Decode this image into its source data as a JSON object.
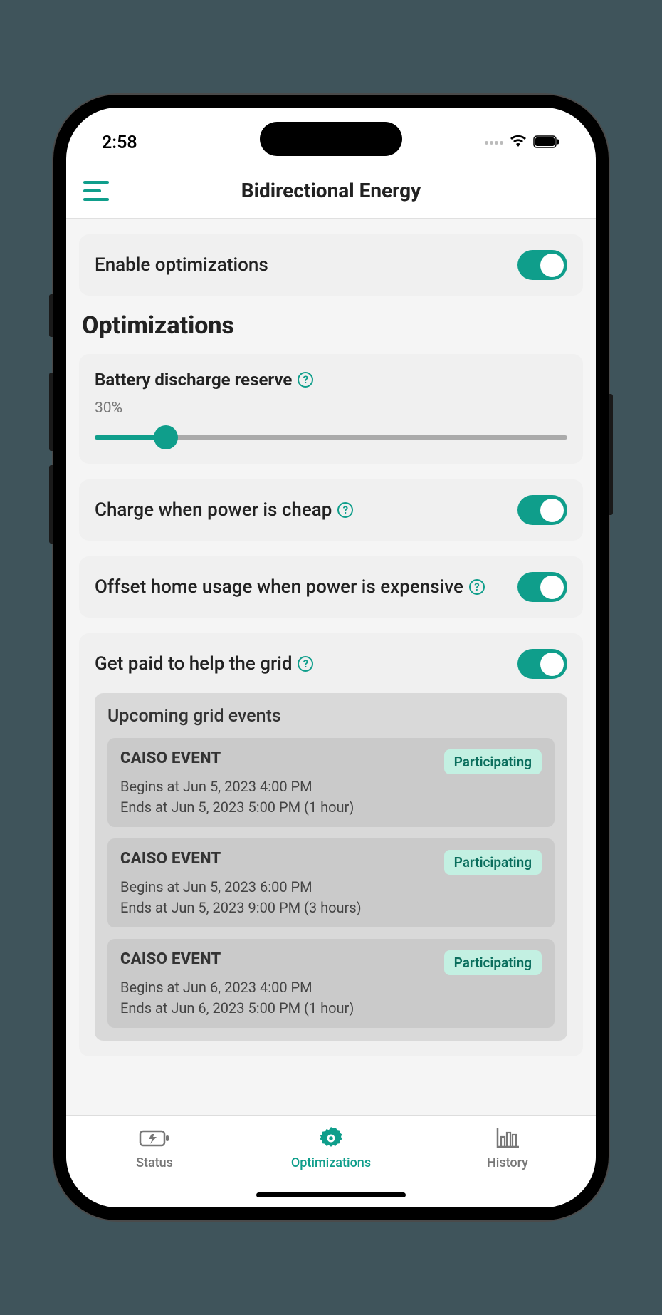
{
  "status_bar": {
    "time": "2:58"
  },
  "header": {
    "title": "Bidirectional Energy"
  },
  "enable": {
    "label": "Enable optimizations",
    "on": true
  },
  "section_title": "Optimizations",
  "battery": {
    "label": "Battery discharge reserve",
    "value_text": "30%",
    "value_pct": 15
  },
  "opts": [
    {
      "label": "Charge when power is cheap",
      "on": true
    },
    {
      "label": "Offset home usage when power is expensive",
      "on": true
    }
  ],
  "grid": {
    "label": "Get paid to help the grid",
    "on": true,
    "sub_title": "Upcoming grid events",
    "events": [
      {
        "name": "CAISO EVENT",
        "badge": "Participating",
        "begins": "Begins at Jun 5, 2023 4:00 PM",
        "ends": "Ends at Jun 5, 2023 5:00 PM (1 hour)"
      },
      {
        "name": "CAISO EVENT",
        "badge": "Participating",
        "begins": "Begins at Jun 5, 2023 6:00 PM",
        "ends": "Ends at Jun 5, 2023 9:00 PM (3 hours)"
      },
      {
        "name": "CAISO EVENT",
        "badge": "Participating",
        "begins": "Begins at Jun 6, 2023 4:00 PM",
        "ends": "Ends at Jun 6, 2023 5:00 PM (1 hour)"
      }
    ]
  },
  "tabs": {
    "status": "Status",
    "optimizations": "Optimizations",
    "history": "History"
  }
}
